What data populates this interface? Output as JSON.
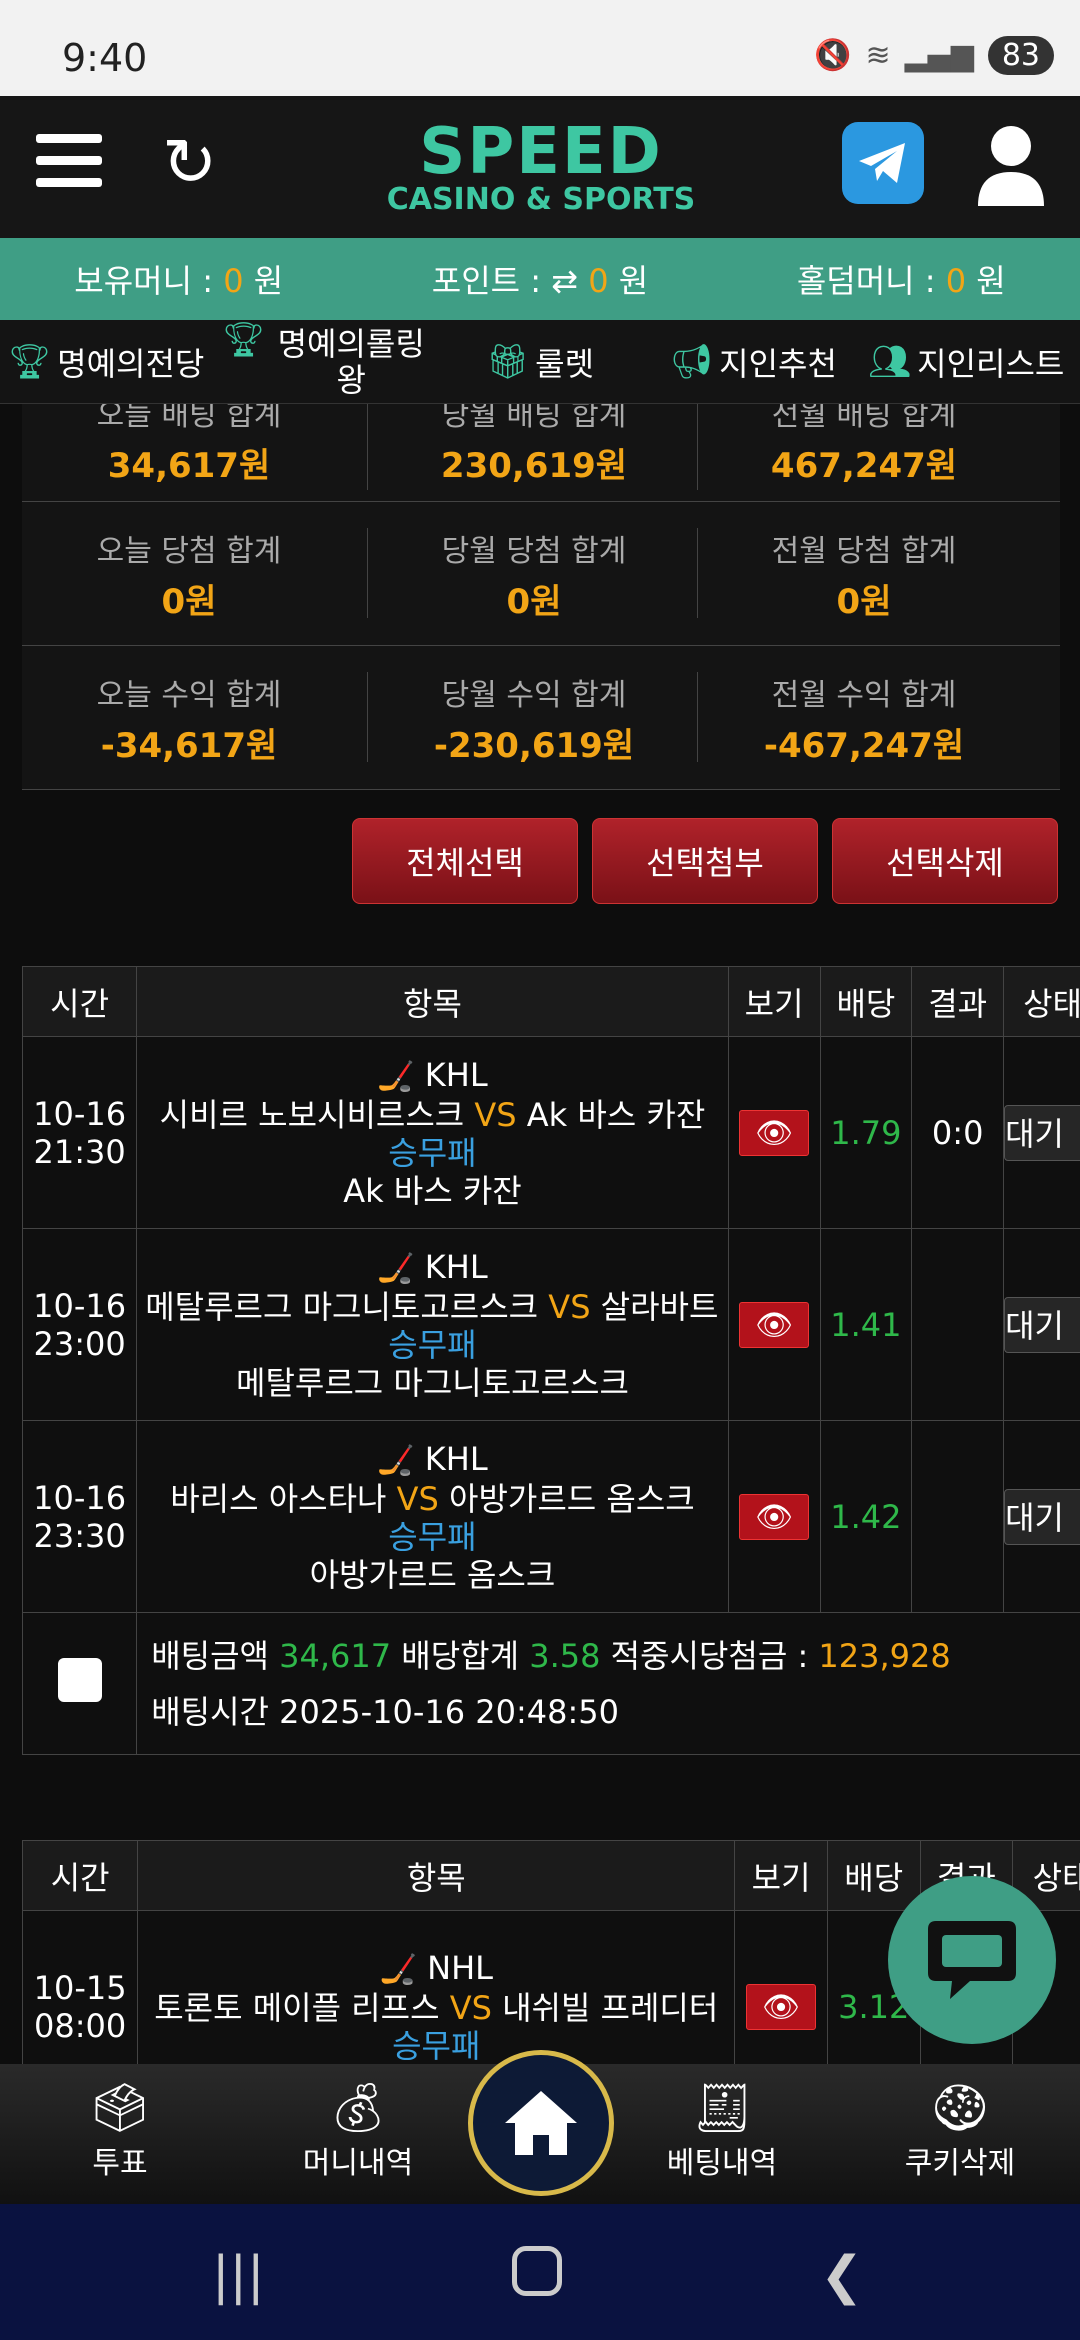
{
  "status": {
    "time": "9:40",
    "battery": "83"
  },
  "header": {
    "logo_main": "SPEED",
    "logo_sub": "CASINO & SPORTS"
  },
  "money": {
    "holding_label": "보유머니 :",
    "holding_value": "0",
    "holding_unit": "원",
    "point_label": "포인트 :",
    "point_value": "0",
    "point_unit": "원",
    "holdem_label": "홀덤머니 :",
    "holdem_value": "0",
    "holdem_unit": "원"
  },
  "menu": [
    {
      "label": "명예의전당",
      "icon": "trophy-icon"
    },
    {
      "label": "명예의롤링 왕",
      "icon": "trophy-icon"
    },
    {
      "label": "룰렛",
      "icon": "gift-icon"
    },
    {
      "label": "지인추천",
      "icon": "megaphone-icon"
    },
    {
      "label": "지인리스트",
      "icon": "users-icon"
    }
  ],
  "summary": {
    "row1": [
      {
        "label": "오늘 배팅 합계",
        "value": "34,617원"
      },
      {
        "label": "당월 배팅 합계",
        "value": "230,619원"
      },
      {
        "label": "전월 배팅 합계",
        "value": "467,247원"
      }
    ],
    "row2": [
      {
        "label": "오늘 당첨 합계",
        "value": "0원"
      },
      {
        "label": "당월 당첨 합계",
        "value": "0원"
      },
      {
        "label": "전월 당첨 합계",
        "value": "0원"
      }
    ],
    "row3": [
      {
        "label": "오늘 수익 합계",
        "value": "-34,617원"
      },
      {
        "label": "당월 수익 합계",
        "value": "-230,619원"
      },
      {
        "label": "전월 수익 합계",
        "value": "-467,247원"
      }
    ]
  },
  "actions": {
    "select_all": "전체선택",
    "attach": "선택첨부",
    "delete": "선택삭제"
  },
  "table_headers": {
    "time": "시간",
    "item": "항목",
    "view": "보기",
    "odds": "배당",
    "result": "결과",
    "status": "상태"
  },
  "bet1": {
    "rows": [
      {
        "date": "10-16",
        "time": "21:30",
        "league": "KHL",
        "home": "시비르 노보시비르스크",
        "vs": "VS",
        "away": "Ak 바스 카잔",
        "market": "승무패",
        "pick": "Ak 바스 카잔",
        "odds": "1.79",
        "result": "0:0",
        "status": "대기"
      },
      {
        "date": "10-16",
        "time": "23:00",
        "league": "KHL",
        "home": "메탈루르그 마그니토고르스크",
        "vs": "VS",
        "away": "살라바트",
        "market": "승무패",
        "pick": "메탈루르그 마그니토고르스크",
        "odds": "1.41",
        "result": "",
        "status": "대기"
      },
      {
        "date": "10-16",
        "time": "23:30",
        "league": "KHL",
        "home": "바리스 아스타나",
        "vs": "VS",
        "away": "아방가르드 옴스크",
        "market": "승무패",
        "pick": "아방가르드 옴스크",
        "odds": "1.42",
        "result": "",
        "status": "대기"
      }
    ],
    "footer": {
      "amount_label": "배팅금액",
      "amount": "34,617",
      "odds_label": "배당합계",
      "odds_total": "3.58",
      "win_label": "적중시당첨금 :",
      "win": "123,928",
      "time_label": "배팅시간",
      "time": "2025-10-16 20:48:50"
    }
  },
  "bet2": {
    "rows": [
      {
        "date": "10-15",
        "time": "08:00",
        "league": "NHL",
        "home": "토론토 메이플 리프스",
        "vs": "VS",
        "away": "내쉬빌 프레디터",
        "market": "승무패",
        "odds": "3.12"
      }
    ]
  },
  "bottom_nav": {
    "vote": "투표",
    "money": "머니내역",
    "betting": "베팅내역",
    "cookie": "쿠키삭제"
  },
  "colors": {
    "accent": "#3f9e85",
    "orange": "#f2a516",
    "green": "#2fb84a",
    "blue": "#3aa0e0",
    "red": "#b3121b"
  }
}
